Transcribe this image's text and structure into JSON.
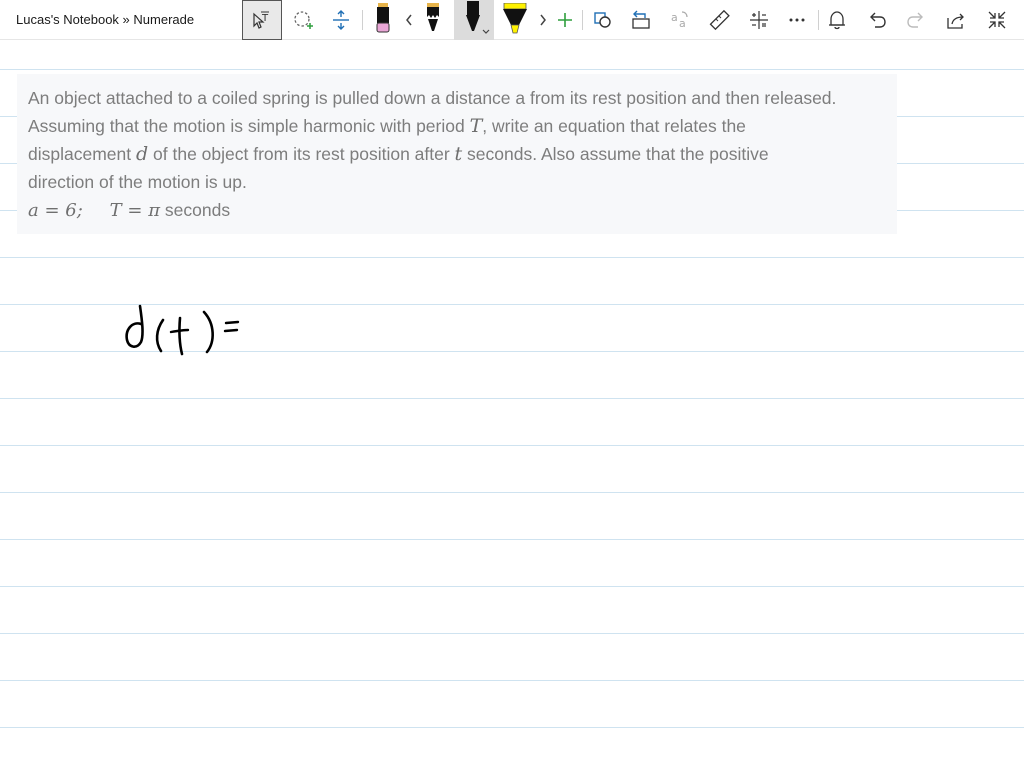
{
  "window": {
    "title": "Lucas's Notebook » Numerade"
  },
  "toolbar": {
    "buttons": [
      {
        "name": "lasso-text-select",
        "icon": "select-cursor-icon"
      },
      {
        "name": "lasso-select",
        "icon": "lasso-icon"
      },
      {
        "name": "insert-space",
        "icon": "insert-space-icon"
      },
      {
        "name": "pen-pink",
        "icon": "pen-icon"
      },
      {
        "name": "pens-prev",
        "icon": "chevron-left-icon"
      },
      {
        "name": "pen-black-fineliner",
        "icon": "pen-icon"
      },
      {
        "name": "pen-black-active",
        "icon": "pen-icon"
      },
      {
        "name": "highlighter-yellow",
        "icon": "highlighter-icon"
      },
      {
        "name": "pens-next",
        "icon": "chevron-right-icon"
      },
      {
        "name": "add-pen",
        "icon": "plus-icon"
      },
      {
        "name": "ink-to-shape",
        "icon": "shapes-icon"
      },
      {
        "name": "lasso-replace",
        "icon": "replace-icon"
      },
      {
        "name": "ink-to-math",
        "icon": "math-icon"
      },
      {
        "name": "ruler",
        "icon": "ruler-icon"
      },
      {
        "name": "math",
        "icon": "math-grid-icon"
      },
      {
        "name": "more",
        "icon": "more-icon"
      },
      {
        "name": "notifications",
        "icon": "bell-icon"
      },
      {
        "name": "undo",
        "icon": "undo-icon"
      },
      {
        "name": "redo",
        "icon": "redo-icon"
      },
      {
        "name": "share",
        "icon": "share-icon"
      },
      {
        "name": "exit-full-screen",
        "icon": "collapse-icon"
      }
    ],
    "pen_colors": {
      "pink": "#e9a6d6",
      "black": "#000000",
      "yellow": "#fff200",
      "green_plus": "#2e9e3d",
      "blue_tools": "#1f6fb5"
    }
  },
  "problem": {
    "line1": "An object attached to a coiled spring is pulled down a distance a from its rest position and then released.",
    "line2_a": "Assuming that the motion is simple harmonic with period ",
    "line2_var": "T",
    "line2_b": ", write an equation that relates the",
    "line3_a": "displacement ",
    "line3_var": "d",
    "line3_b": " of the object from its rest position after ",
    "line3_var2": "t",
    "line3_c": " seconds. Also assume that the positive",
    "line4": "direction of the motion is up.",
    "params_a": "a = 6;",
    "params_T": "T = π",
    "params_unit": "seconds"
  },
  "handwriting": {
    "text": "d(t) ="
  },
  "colors": {
    "rule_line": "#cfe3f0",
    "problem_bg": "#f7f8fa",
    "problem_text": "#7d7d7d"
  }
}
